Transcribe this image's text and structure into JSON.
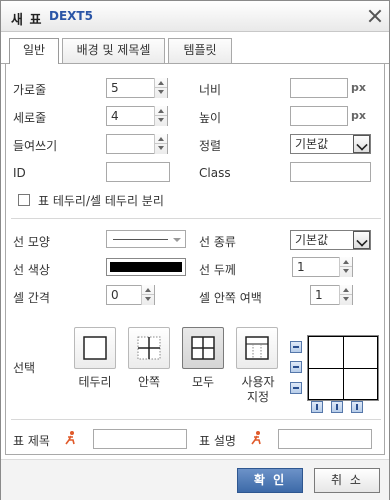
{
  "dialog": {
    "title": "새 표",
    "brand": "DEXT5"
  },
  "tabs": [
    {
      "label": "일반",
      "active": true
    },
    {
      "label": "배경 및 제목셀",
      "active": false
    },
    {
      "label": "템플릿",
      "active": false
    }
  ],
  "general": {
    "rows_label": "가로줄",
    "rows_value": "5",
    "cols_label": "세로줄",
    "cols_value": "4",
    "indent_label": "들여쓰기",
    "indent_value": "",
    "width_label": "너비",
    "width_value": "",
    "width_unit": "px",
    "height_label": "높이",
    "height_value": "",
    "height_unit": "px",
    "align_label": "정렬",
    "align_value": "기본값",
    "id_label": "ID",
    "id_value": "",
    "class_label": "Class",
    "class_value": "",
    "separate_border_label": "표 테두리/셀 테두리 분리",
    "separate_border_checked": false
  },
  "border": {
    "line_style_label": "선 모양",
    "line_type_label": "선 종류",
    "line_type_value": "기본값",
    "line_color_label": "선 색상",
    "line_color": "#000000",
    "line_width_label": "선 두께",
    "line_width_value": "1",
    "cell_spacing_label": "셀 간격",
    "cell_spacing_value": "0",
    "cell_padding_label": "셀 안쪽 여백",
    "cell_padding_value": "1"
  },
  "selection": {
    "label": "선택",
    "options": [
      {
        "label": "테두리",
        "icon": "outer-border-icon"
      },
      {
        "label": "안쪽",
        "icon": "inner-border-icon"
      },
      {
        "label": "모두",
        "icon": "all-border-icon",
        "selected": true
      },
      {
        "label": "사용자\n지정",
        "icon": "custom-border-icon"
      }
    ]
  },
  "caption": {
    "title_label": "표 제목",
    "title_value": "",
    "summary_label": "표 설명",
    "summary_value": ""
  },
  "buttons": {
    "ok": "확 인",
    "cancel": "취 소"
  },
  "colors": {
    "brand": "#2a55a6",
    "ok_button": "#4a76b5"
  }
}
